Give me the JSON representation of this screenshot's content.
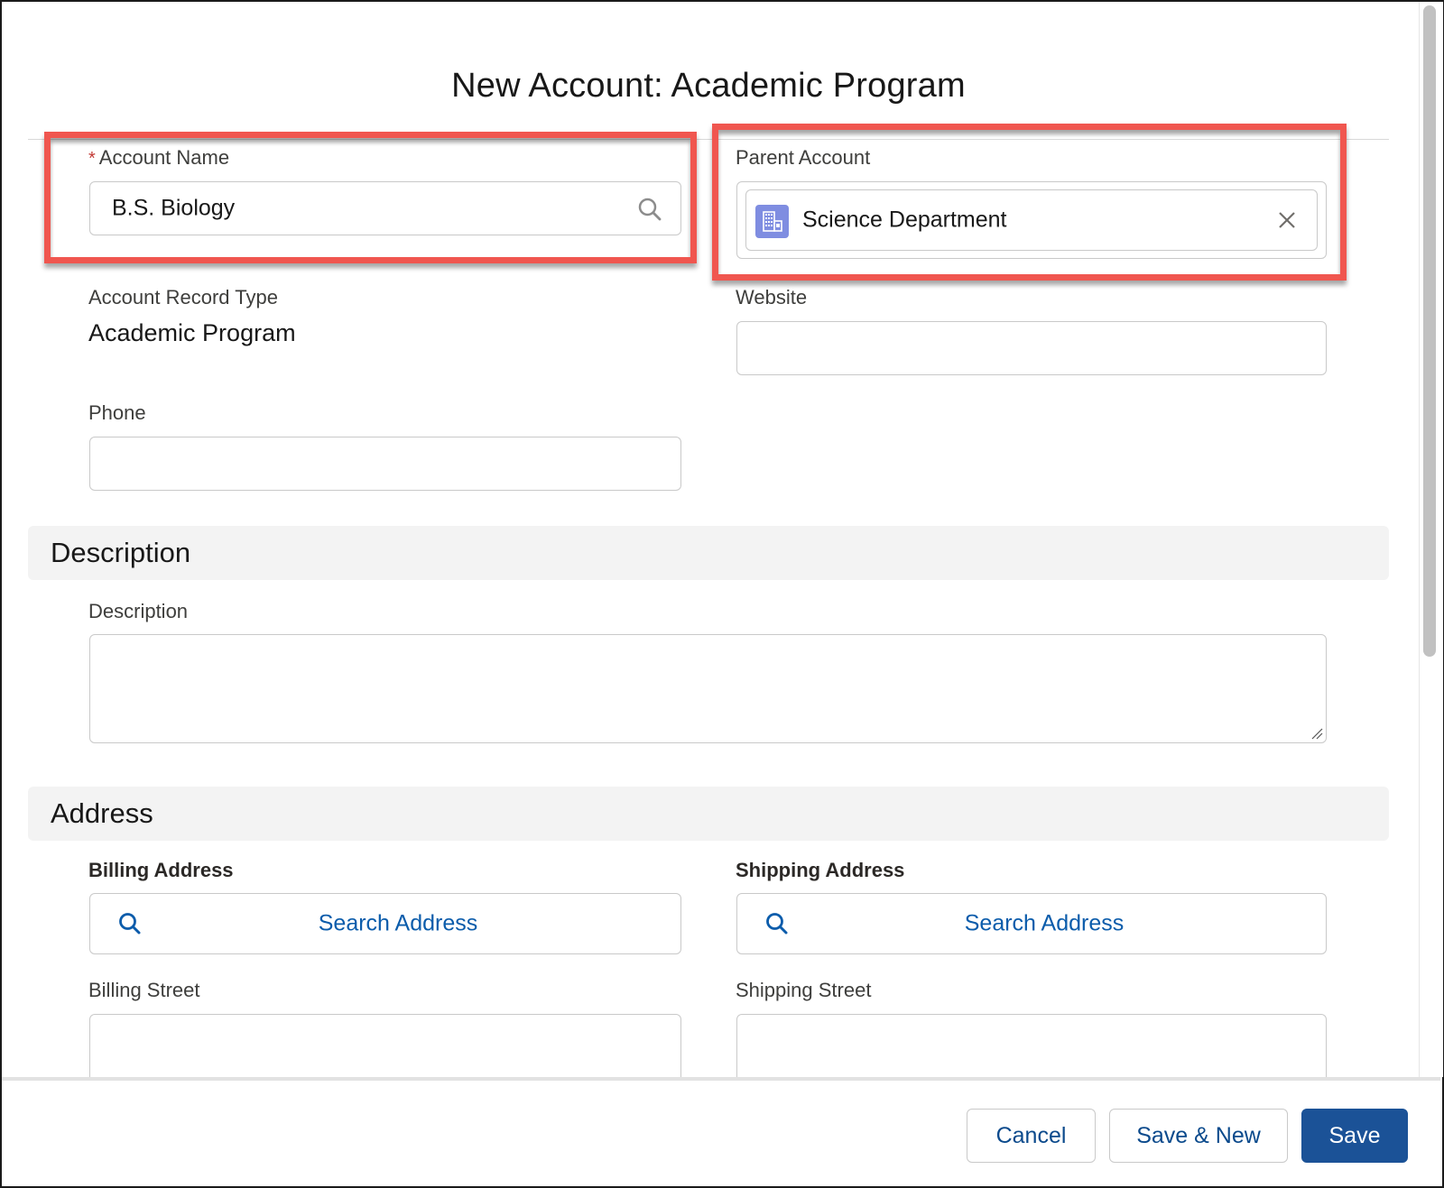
{
  "modal": {
    "title": "New Account: Academic Program"
  },
  "fields": {
    "account_name": {
      "label": "Account Name",
      "required_marker": "*",
      "value": "B.S. Biology",
      "icon": "search-icon"
    },
    "parent_account": {
      "label": "Parent Account",
      "selected": "Science Department",
      "icon": "account-building-icon",
      "clear_icon": "close-icon"
    },
    "record_type": {
      "label": "Account Record Type",
      "value": "Academic Program"
    },
    "website": {
      "label": "Website",
      "value": ""
    },
    "phone": {
      "label": "Phone",
      "value": ""
    }
  },
  "sections": {
    "description": {
      "header": "Description",
      "field_label": "Description",
      "value": ""
    },
    "address": {
      "header": "Address",
      "billing_address_label": "Billing Address",
      "shipping_address_label": "Shipping Address",
      "search_address_label": "Search Address",
      "billing_street_label": "Billing Street",
      "shipping_street_label": "Shipping Street"
    }
  },
  "footer": {
    "cancel": "Cancel",
    "save_new": "Save & New",
    "save": "Save"
  },
  "colors": {
    "annotation": "#f0564f",
    "brand_button": "#1b5297",
    "link_blue": "#0b5cab",
    "account_icon": "#7f8de1",
    "required": "#c23934"
  }
}
